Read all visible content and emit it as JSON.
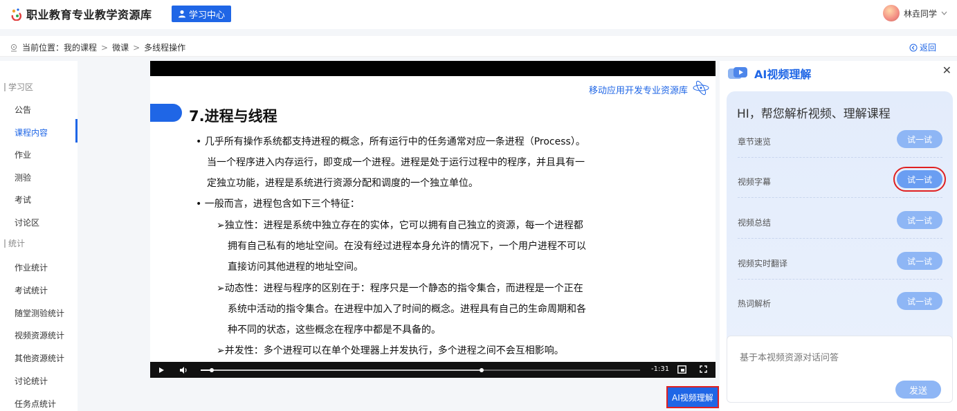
{
  "header": {
    "site_name": "职业教育专业教学资源库",
    "learn_center": "学习中心",
    "user_name": "林垚同学"
  },
  "breadcrumb": {
    "prefix": "当前位置：",
    "items": [
      "我的课程",
      "微课",
      "多线程操作"
    ],
    "back": "返回"
  },
  "sidebar": {
    "study_section": "学习区",
    "study_items": [
      "公告",
      "课程内容",
      "作业",
      "测验",
      "考试",
      "讨论区"
    ],
    "stats_section": "统计",
    "stats_items": [
      "作业统计",
      "考试统计",
      "随堂测验统计",
      "视频资源统计",
      "其他资源统计",
      "讨论统计",
      "任务点统计"
    ],
    "active_item": "课程内容"
  },
  "video": {
    "brand": "移动应用开发专业资源库",
    "title": "7.进程与线程",
    "lines": [
      "•  几乎所有操作系统都支持进程的概念，所有运行中的任务通常对应一条进程（Process）。",
      "当一个程序进入内存运行，即变成一个进程。进程是处于运行过程中的程序，并且具有一",
      "定独立功能，进程是系统进行资源分配和调度的一个独立单位。",
      "•  一般而言，进程包含如下三个特征：",
      "➢独立性：进程是系统中独立存在的实体，它可以拥有自己独立的资源，每一个进程都",
      "拥有自己私有的地址空间。在没有经过进程本身允许的情况下，一个用户进程不可以",
      "直接访问其他进程的地址空间。",
      "➢动态性：进程与程序的区别在于：程序只是一个静态的指令集合，而进程是一个正在",
      "系统中活动的指令集合。在进程中加入了时间的概念。进程具有自己的生命周期和各",
      "种不同的状态，这些概念在程序中都是不具备的。",
      "➢并发性：多个进程可以在单个处理器上并发执行，多个进程之间不会互相影响。"
    ],
    "time_remaining": "-1:31",
    "played_fraction": 0.025,
    "buffered_fraction": 0.64
  },
  "ai_button": "AI视频理解",
  "ai_panel": {
    "title": "AI视频理解",
    "greeting": "HI，帮您解析视频、理解课程",
    "features": [
      {
        "label": "章节速览",
        "action": "试一试"
      },
      {
        "label": "视频字幕",
        "action": "试一试"
      },
      {
        "label": "视频总结",
        "action": "试一试"
      },
      {
        "label": "视频实时翻译",
        "action": "试一试"
      },
      {
        "label": "热词解析",
        "action": "试一试"
      }
    ],
    "chat_placeholder": "基于本视频资源对话问答",
    "send": "发送"
  },
  "colors": {
    "accent": "#1f66e6",
    "highlight": "#e02020"
  }
}
